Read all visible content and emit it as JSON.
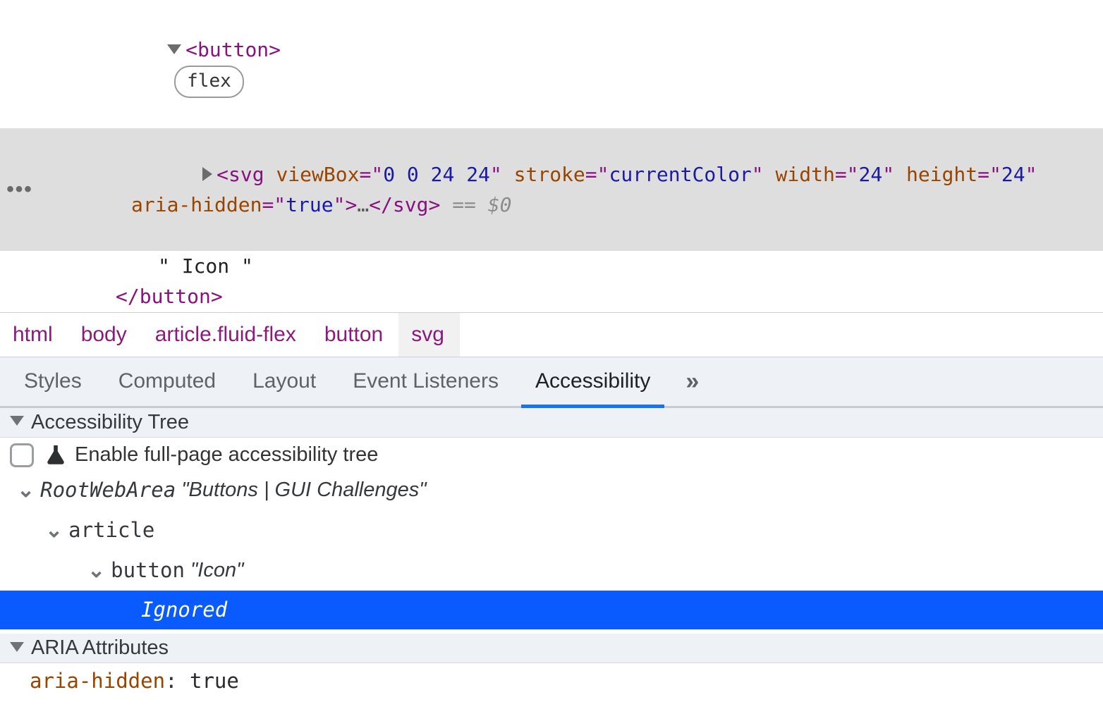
{
  "dom": {
    "button_open": "<button>",
    "flex_pill": "flex",
    "svg": {
      "tag": "svg",
      "attrs": [
        {
          "name": "viewBox",
          "value": "0 0 24 24"
        },
        {
          "name": "stroke",
          "value": "currentColor"
        },
        {
          "name": "width",
          "value": "24"
        },
        {
          "name": "height",
          "value": "24"
        },
        {
          "name": "aria-hidden",
          "value": "true"
        }
      ],
      "ellipsis": "…",
      "close": "</svg>",
      "eqvar": "== $0"
    },
    "text_node": "\" Icon \"",
    "button_close": "</button>"
  },
  "breadcrumb": [
    "html",
    "body",
    "article.fluid-flex",
    "button",
    "svg"
  ],
  "tabs": [
    "Styles",
    "Computed",
    "Layout",
    "Event Listeners",
    "Accessibility"
  ],
  "tabs_active": "Accessibility",
  "tabs_more": "»",
  "sections": {
    "tree_title": "Accessibility Tree",
    "enable_label": "Enable full-page accessibility tree",
    "aria_title": "ARIA Attributes"
  },
  "tree": {
    "root_role": "RootWebArea",
    "root_name": "\"Buttons | GUI Challenges\"",
    "article_role": "article",
    "button_role": "button",
    "button_name": "\"Icon\"",
    "ignored": "Ignored"
  },
  "aria": {
    "key": "aria-hidden",
    "value": "true"
  },
  "gutter_dots": "•••"
}
